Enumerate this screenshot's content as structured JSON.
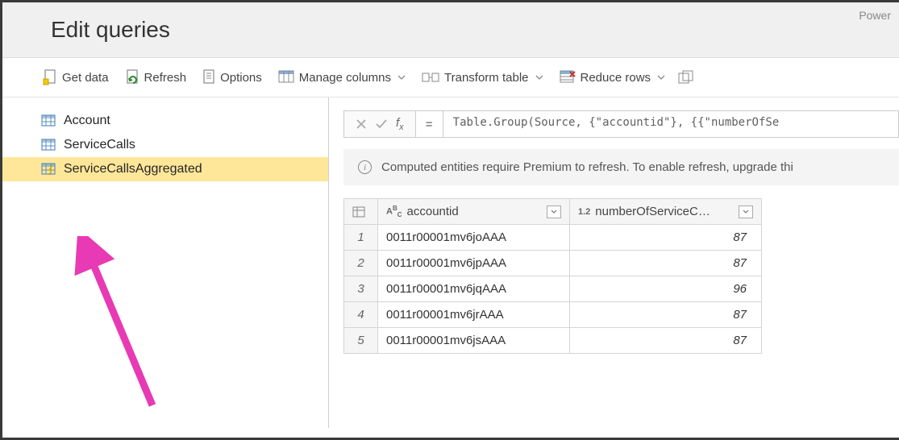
{
  "brand": "Power",
  "header": {
    "title": "Edit queries"
  },
  "toolbar": {
    "getData": "Get data",
    "refresh": "Refresh",
    "options": "Options",
    "manageColumns": "Manage columns",
    "transformTable": "Transform table",
    "reduceRows": "Reduce rows"
  },
  "queries": [
    {
      "name": "Account",
      "selected": false,
      "computed": false
    },
    {
      "name": "ServiceCalls",
      "selected": false,
      "computed": false
    },
    {
      "name": "ServiceCallsAggregated",
      "selected": true,
      "computed": true
    }
  ],
  "formulaBar": {
    "eq": "=",
    "text": "Table.Group(Source, {\"accountid\"}, {{\"numberOfSe"
  },
  "banner": {
    "text": "Computed entities require Premium to refresh. To enable refresh, upgrade thi"
  },
  "table": {
    "columns": [
      {
        "typeLabel": "ABC",
        "name": "accountid"
      },
      {
        "typeLabel": "1.2",
        "name": "numberOfServiceC…"
      }
    ],
    "rows": [
      {
        "n": "1",
        "accountid": "0011r00001mv6joAAA",
        "value": "87"
      },
      {
        "n": "2",
        "accountid": "0011r00001mv6jpAAA",
        "value": "87"
      },
      {
        "n": "3",
        "accountid": "0011r00001mv6jqAAA",
        "value": "96"
      },
      {
        "n": "4",
        "accountid": "0011r00001mv6jrAAA",
        "value": "87"
      },
      {
        "n": "5",
        "accountid": "0011r00001mv6jsAAA",
        "value": "87"
      }
    ]
  }
}
